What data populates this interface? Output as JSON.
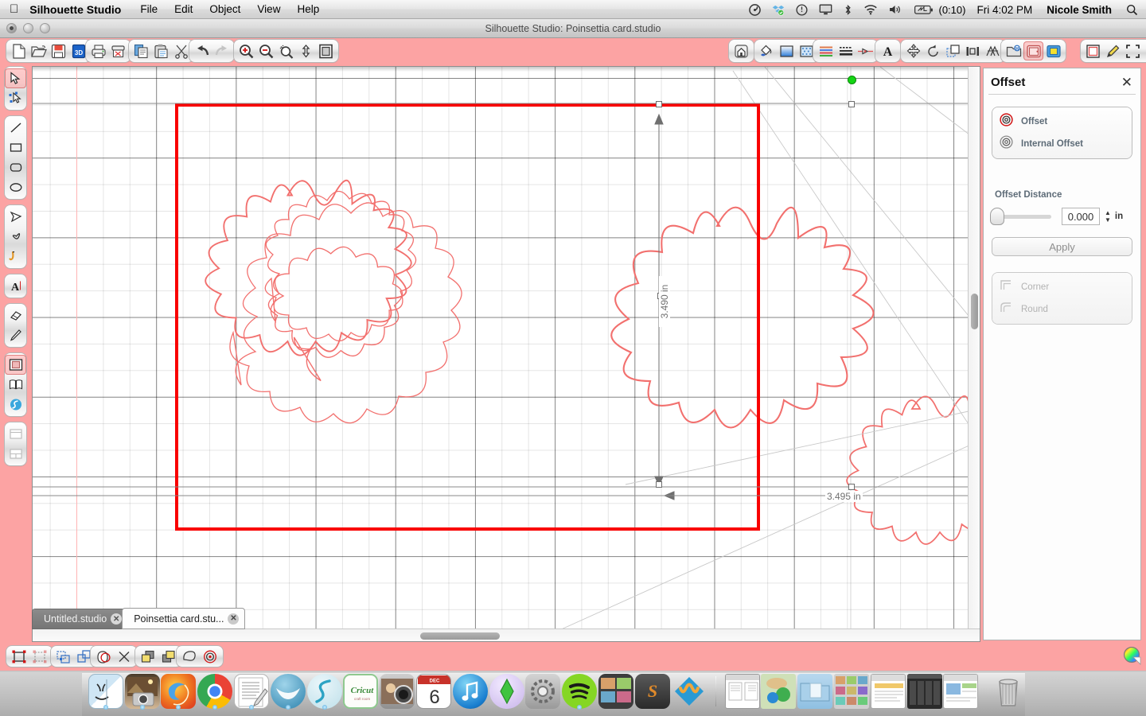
{
  "menubar": {
    "apple_icon": "apple-logo-icon",
    "app_name": "Silhouette Studio",
    "items": [
      "File",
      "Edit",
      "Object",
      "View",
      "Help"
    ],
    "status_icons": [
      "wheel-icon",
      "dropbox-icon",
      "clock-icon",
      "display-icon",
      "bluetooth-icon",
      "wifi-icon",
      "volume-icon"
    ],
    "battery_time": "(0:10)",
    "time": "Fri 4:02 PM",
    "user": "Nicole Smith",
    "search_icon": "spotlight-search-icon"
  },
  "window": {
    "title": "Silhouette Studio: Poinsettia card.studio"
  },
  "toolbar": {
    "groups": [
      {
        "name": "file-group",
        "buttons": [
          {
            "name": "new-document-button",
            "icon": "page-icon"
          },
          {
            "name": "open-document-button",
            "icon": "folder-open-icon"
          },
          {
            "name": "save-document-button",
            "icon": "floppy-disk-icon"
          },
          {
            "name": "save-as-studio-button",
            "icon": "blue-save-icon"
          }
        ]
      },
      {
        "name": "print-group",
        "buttons": [
          {
            "name": "print-button",
            "icon": "printer-icon"
          },
          {
            "name": "send-to-silhouette-button",
            "icon": "cutter-icon"
          }
        ]
      },
      {
        "name": "clipboard-group",
        "buttons": [
          {
            "name": "copy-button",
            "icon": "copy-icon"
          },
          {
            "name": "paste-button",
            "icon": "paste-icon"
          },
          {
            "name": "cut-button",
            "icon": "scissors-icon"
          }
        ]
      },
      {
        "name": "history-group",
        "buttons": [
          {
            "name": "undo-button",
            "icon": "undo-arrow-icon"
          },
          {
            "name": "redo-button",
            "icon": "redo-arrow-icon"
          }
        ]
      },
      {
        "name": "zoom-group",
        "buttons": [
          {
            "name": "zoom-in-button",
            "icon": "magnifier-plus-icon"
          },
          {
            "name": "zoom-out-button",
            "icon": "magnifier-minus-icon"
          },
          {
            "name": "zoom-selection-button",
            "icon": "magnifier-selection-icon"
          },
          {
            "name": "pan-button",
            "icon": "pan-hand-icon"
          },
          {
            "name": "fit-to-page-button",
            "icon": "fit-page-icon"
          }
        ]
      },
      {
        "name": "home-group",
        "buttons": [
          {
            "name": "design-page-button",
            "icon": "home-icon"
          }
        ]
      },
      {
        "name": "fill-group",
        "buttons": [
          {
            "name": "fill-color-button",
            "icon": "paint-bucket-icon"
          },
          {
            "name": "gradient-fill-button",
            "icon": "gradient-icon"
          },
          {
            "name": "pattern-fill-button",
            "icon": "pattern-icon"
          }
        ]
      },
      {
        "name": "line-group",
        "buttons": [
          {
            "name": "line-color-button",
            "icon": "line-color-icon"
          },
          {
            "name": "line-style-button",
            "icon": "line-style-icon"
          },
          {
            "name": "sketch-pens-button",
            "icon": "sketch-pen-icon"
          }
        ]
      },
      {
        "name": "text-group",
        "buttons": [
          {
            "name": "text-style-button",
            "icon": "text-a-icon"
          }
        ]
      },
      {
        "name": "transform-group",
        "buttons": [
          {
            "name": "move-button",
            "icon": "move-arrows-icon"
          },
          {
            "name": "rotate-button",
            "icon": "rotate-icon"
          },
          {
            "name": "scale-button",
            "icon": "scale-icon"
          },
          {
            "name": "align-button",
            "icon": "align-icon"
          },
          {
            "name": "replicate-button",
            "icon": "replicate-icon"
          }
        ]
      },
      {
        "name": "library-group",
        "buttons": [
          {
            "name": "my-library-button",
            "icon": "library-icon"
          },
          {
            "name": "offset-button",
            "icon": "offset-panel-icon"
          },
          {
            "name": "trace-button",
            "icon": "trace-icon"
          }
        ]
      },
      {
        "name": "page-group",
        "buttons": [
          {
            "name": "page-setup-button",
            "icon": "page-setup-icon"
          },
          {
            "name": "cut-settings-button",
            "icon": "pencil-cut-icon"
          },
          {
            "name": "registration-marks-button",
            "icon": "reg-marks-icon"
          },
          {
            "name": "grid-settings-button",
            "icon": "grid-icon"
          }
        ]
      }
    ]
  },
  "tools": {
    "groups": [
      [
        {
          "name": "select-tool",
          "icon": "arrow-cursor-icon",
          "selected": true
        },
        {
          "name": "edit-points-tool",
          "icon": "point-edit-icon",
          "selected": false
        }
      ],
      [
        {
          "name": "line-tool",
          "icon": "line-icon",
          "selected": false
        },
        {
          "name": "rectangle-tool",
          "icon": "rectangle-icon",
          "selected": false
        },
        {
          "name": "rounded-rectangle-tool",
          "icon": "rounded-rect-icon",
          "selected": false
        },
        {
          "name": "ellipse-tool",
          "icon": "ellipse-icon",
          "selected": false
        }
      ],
      [
        {
          "name": "polygon-tool",
          "icon": "polygon-icon",
          "selected": false
        },
        {
          "name": "curve-tool",
          "icon": "curve-icon",
          "selected": false
        },
        {
          "name": "freehand-tool",
          "icon": "freehand-pen-icon",
          "selected": false
        }
      ],
      [
        {
          "name": "text-tool",
          "icon": "text-a-icon",
          "selected": false
        }
      ],
      [
        {
          "name": "eraser-tool",
          "icon": "eraser-icon",
          "selected": false
        },
        {
          "name": "knife-tool",
          "icon": "knife-icon",
          "selected": false
        }
      ],
      [
        {
          "name": "fill-panel-tool",
          "icon": "fill-swatch-icon",
          "selected": true
        },
        {
          "name": "library-tool",
          "icon": "book-icon",
          "selected": false
        },
        {
          "name": "store-tool",
          "icon": "silhouette-store-icon",
          "selected": false
        }
      ],
      [
        {
          "name": "page-setup-tool",
          "icon": "page-layout-icon",
          "selected": false
        },
        {
          "name": "panel-layout-tool",
          "icon": "panel-layout-icon",
          "selected": false
        }
      ]
    ]
  },
  "canvas": {
    "dimensions": {
      "height_label": "3.490 in",
      "width_label": "3.495 in"
    },
    "cut_border_color": "#f90000",
    "artwork_color": "#f2706e",
    "rotation_handle": "green-rotation-handle"
  },
  "tabs": [
    {
      "name": "tab-untitled",
      "label": "Untitled.studio",
      "active": false
    },
    {
      "name": "tab-poinsettia-card",
      "label": "Poinsettia card.stu...",
      "active": true
    }
  ],
  "bottombar": {
    "groups": [
      [
        {
          "name": "group-button",
          "icon": "group-icon"
        },
        {
          "name": "ungroup-button",
          "icon": "ungroup-icon"
        }
      ],
      [
        {
          "name": "make-compound-path-button",
          "icon": "compound-path-icon"
        },
        {
          "name": "release-compound-path-button",
          "icon": "release-path-icon"
        }
      ],
      [
        {
          "name": "weld-button",
          "icon": "weld-icon"
        },
        {
          "name": "subtract-button",
          "icon": "subtract-x-icon"
        }
      ],
      [
        {
          "name": "bring-to-front-button",
          "icon": "bring-front-icon"
        },
        {
          "name": "send-to-back-button",
          "icon": "send-back-icon"
        }
      ],
      [
        {
          "name": "merge-button",
          "icon": "merge-shape-icon"
        },
        {
          "name": "offset-shortcut-button",
          "icon": "offset-target-icon"
        }
      ]
    ],
    "color_wheel": "color-wheel-icon"
  },
  "panel": {
    "title": "Offset",
    "close_icon": "close-x-icon",
    "modes": [
      {
        "name": "offset-mode",
        "label": "Offset",
        "icon": "offset-ring-icon",
        "selected": true
      },
      {
        "name": "internal-offset-mode",
        "label": "Internal Offset",
        "icon": "internal-offset-ring-icon",
        "selected": false
      }
    ],
    "distance_label": "Offset Distance",
    "distance_value": "0.000",
    "distance_unit": "in",
    "apply_label": "Apply",
    "corner_options": [
      {
        "name": "corner-option",
        "label": "Corner",
        "icon": "sharp-corner-icon"
      },
      {
        "name": "round-option",
        "label": "Round",
        "icon": "round-corner-icon"
      }
    ]
  },
  "dock": {
    "items": [
      {
        "name": "dock-finder",
        "icon": "finder-icon",
        "running": true
      },
      {
        "name": "dock-iphoto",
        "icon": "iphoto-icon",
        "running": true
      },
      {
        "name": "dock-firefox",
        "icon": "firefox-icon",
        "running": true
      },
      {
        "name": "dock-chrome",
        "icon": "chrome-icon",
        "running": true
      },
      {
        "name": "dock-textedit",
        "icon": "textedit-icon",
        "running": true
      },
      {
        "name": "dock-openoffice",
        "icon": "openoffice-icon",
        "running": true
      },
      {
        "name": "dock-silhouette-studio",
        "icon": "silhouette-icon",
        "running": true
      },
      {
        "name": "dock-cricut",
        "icon": "cricut-icon",
        "running": false
      },
      {
        "name": "dock-photobooth",
        "icon": "photobooth-icon",
        "running": false
      },
      {
        "name": "dock-calendar",
        "icon": "calendar-icon",
        "running": false,
        "day": "6",
        "month": "DEC"
      },
      {
        "name": "dock-itunes",
        "icon": "itunes-icon",
        "running": false
      },
      {
        "name": "dock-sims",
        "icon": "sims-icon",
        "running": false
      },
      {
        "name": "dock-system-preferences",
        "icon": "system-preferences-icon",
        "running": false
      },
      {
        "name": "dock-spotify",
        "icon": "spotify-icon",
        "running": true
      },
      {
        "name": "dock-photo-manager",
        "icon": "photo-manager-icon",
        "running": false
      },
      {
        "name": "dock-scrivener",
        "icon": "scrivener-icon",
        "running": false
      },
      {
        "name": "dock-wacom",
        "icon": "wacom-icon",
        "running": false
      }
    ],
    "stacks": [
      {
        "name": "dock-documents-window",
        "icon": "document-preview-icon"
      },
      {
        "name": "dock-craft-window",
        "icon": "craft-preview-icon"
      },
      {
        "name": "dock-downloads-folder",
        "icon": "folder-icon"
      },
      {
        "name": "dock-photos-stack",
        "icon": "photos-stack-icon"
      },
      {
        "name": "dock-browser-window-1",
        "icon": "browser-window-icon"
      },
      {
        "name": "dock-dark-window",
        "icon": "dark-window-icon"
      },
      {
        "name": "dock-browser-window-2",
        "icon": "browser-window-icon"
      },
      {
        "name": "dock-trash",
        "icon": "trash-icon"
      }
    ]
  }
}
